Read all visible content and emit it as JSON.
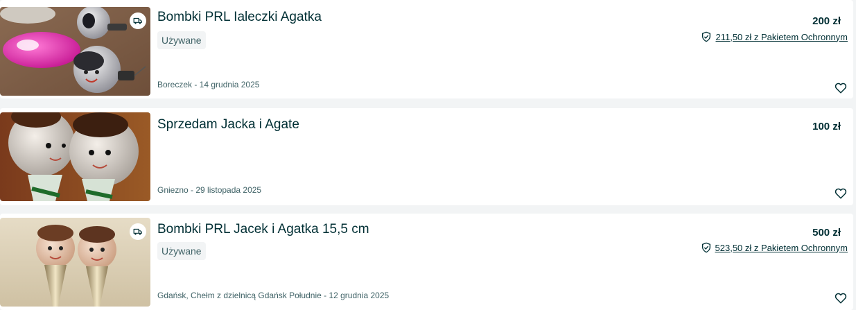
{
  "listings": [
    {
      "title": "Bombki PRL Ialeczki Agatka",
      "condition": "Używane",
      "location_date": "Boreczek - 14 grudnia 2025",
      "price": "200 zł",
      "protection_price": "211,50 zł z Pakietem Ochronnym",
      "has_delivery": true,
      "thumb_icon": "glass-ornaments-photo"
    },
    {
      "title": "Sprzedam Jacka i Agate",
      "condition": "",
      "location_date": "Gniezno - 29 listopada 2025",
      "price": "100 zł",
      "protection_price": "",
      "has_delivery": false,
      "thumb_icon": "glass-ornaments-photo"
    },
    {
      "title": "Bombki PRL Jacek i Agatka 15,5 cm",
      "condition": "Używane",
      "location_date": "Gdańsk, Chełm z dzielnicą Gdańsk Południe - 12 grudnia 2025",
      "price": "500 zł",
      "protection_price": "523,50 zł z Pakietem Ochronnym",
      "has_delivery": true,
      "thumb_icon": "glass-ornaments-photo"
    }
  ],
  "icons": {
    "delivery": "delivery-truck-icon",
    "shield": "shield-check-icon",
    "favorite": "heart-outline-icon"
  },
  "colors": {
    "text_primary": "#002f34",
    "text_secondary": "#406367",
    "page_bg": "#f2f4f5",
    "card_bg": "#ffffff"
  }
}
